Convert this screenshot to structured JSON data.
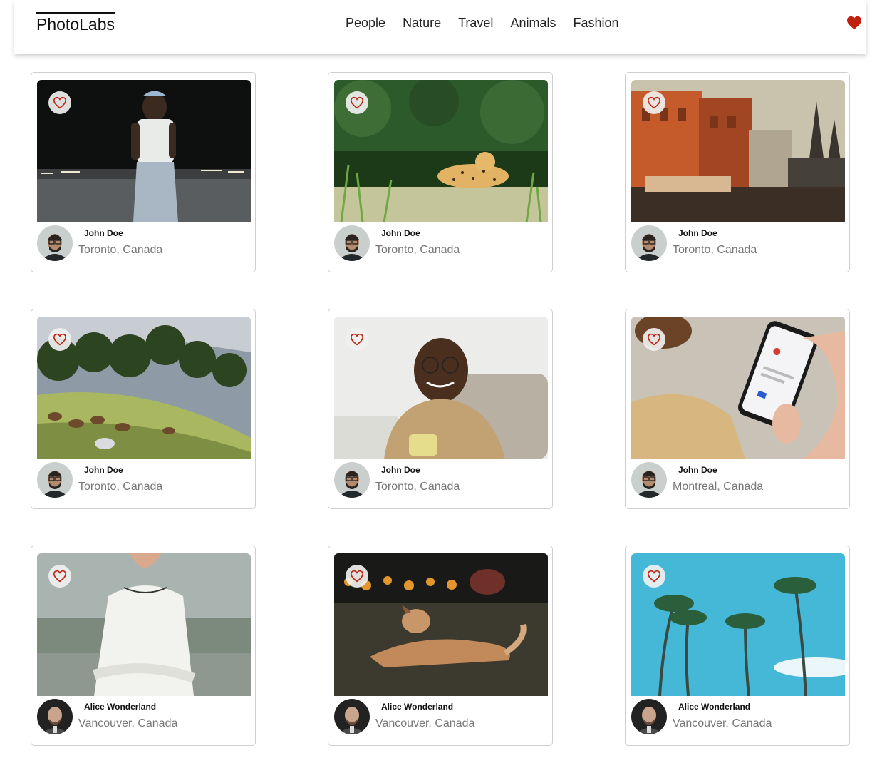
{
  "nav": {
    "logo": "PhotoLabs",
    "topics": [
      "People",
      "Nature",
      "Travel",
      "Animals",
      "Fashion"
    ],
    "fav_icon": "heart-filled-icon",
    "accent": "#c0210f"
  },
  "photos": [
    {
      "user": "John Doe",
      "location": "Toronto, Canada",
      "scene": "person-night-street",
      "avatar": "glasses-man"
    },
    {
      "user": "John Doe",
      "location": "Toronto, Canada",
      "scene": "jaguar-grass",
      "avatar": "glasses-man"
    },
    {
      "user": "John Doe",
      "location": "Toronto, Canada",
      "scene": "old-town-buildings",
      "avatar": "glasses-man"
    },
    {
      "user": "John Doe",
      "location": "Toronto, Canada",
      "scene": "horses-hillside",
      "avatar": "glasses-man"
    },
    {
      "user": "John Doe",
      "location": "Toronto, Canada",
      "scene": "man-with-mug",
      "avatar": "glasses-man"
    },
    {
      "user": "John Doe",
      "location": "Montreal, Canada",
      "scene": "hand-with-phone",
      "avatar": "glasses-man"
    },
    {
      "user": "Alice Wonderland",
      "location": "Vancouver, Canada",
      "scene": "woman-white-top",
      "avatar": "bald-man"
    },
    {
      "user": "Alice Wonderland",
      "location": "Vancouver, Canada",
      "scene": "dog-on-grass",
      "avatar": "bald-man"
    },
    {
      "user": "Alice Wonderland",
      "location": "Vancouver, Canada",
      "scene": "palm-trees-sky",
      "avatar": "bald-man"
    }
  ]
}
